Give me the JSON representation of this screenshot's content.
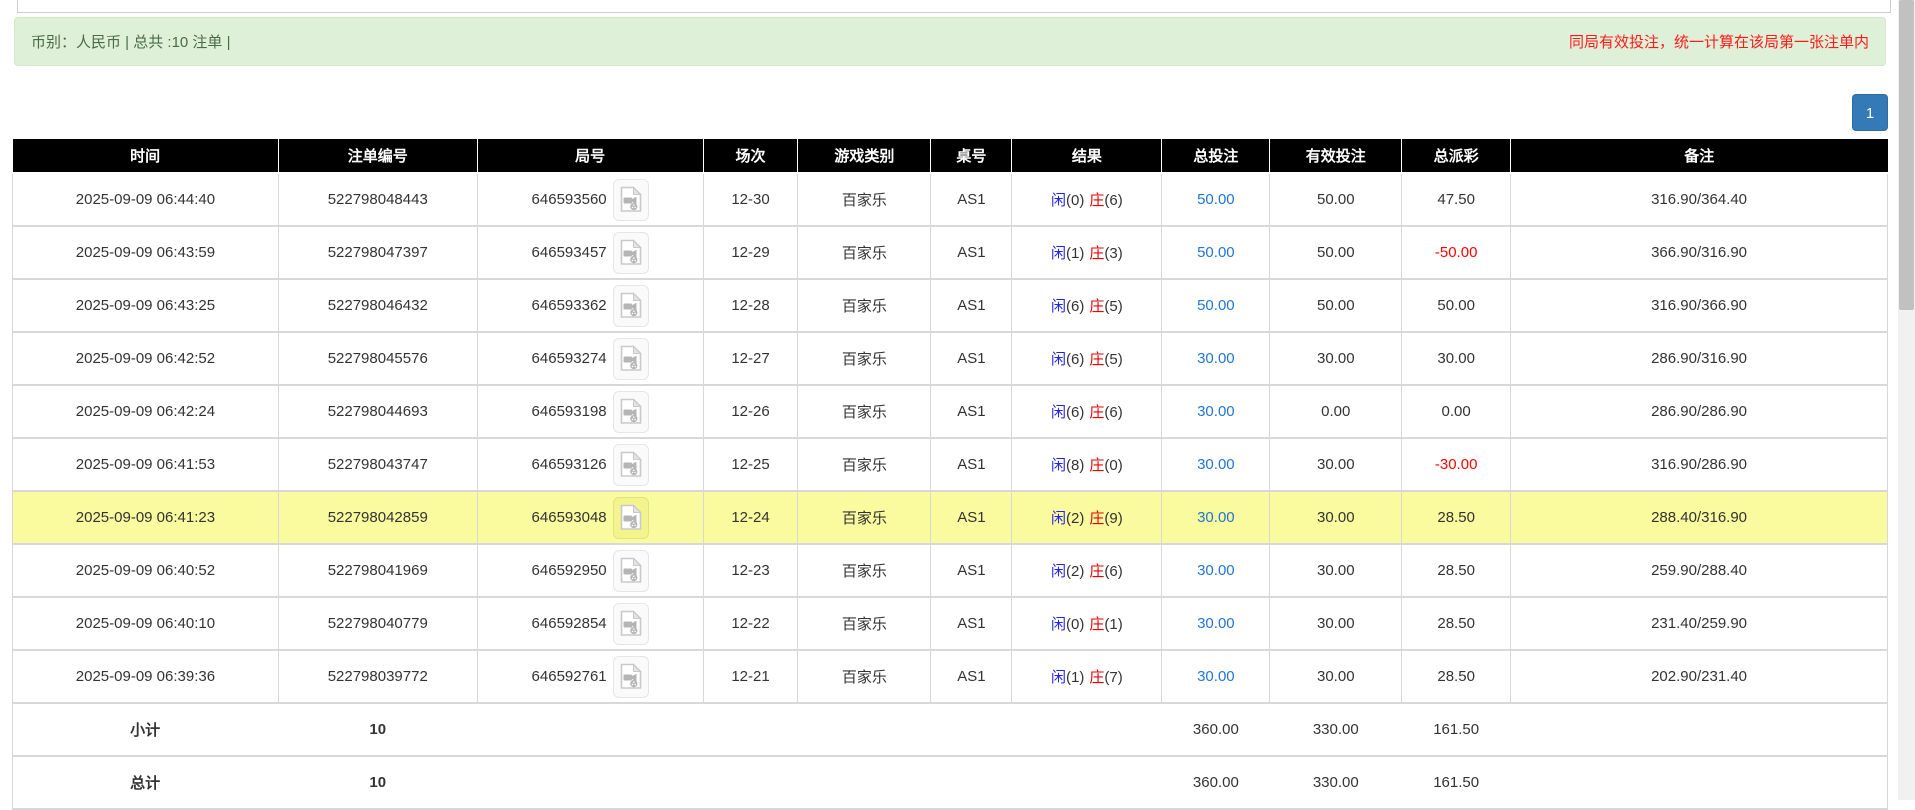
{
  "banner": {
    "left": "币别：人民币 | 总共 :10 注单 |",
    "right": "同局有效投注，统一计算在该局第一张注单内"
  },
  "pagination": {
    "page": "1"
  },
  "table": {
    "headers": [
      "时间",
      "注单编号",
      "局号",
      "场次",
      "游戏类别",
      "桌号",
      "结果",
      "总投注",
      "有效投注",
      "总派彩",
      "备注"
    ],
    "rows": [
      {
        "time": "2025-09-09 06:44:40",
        "bet_id": "522798048443",
        "round_id": "646593560",
        "session": "12-30",
        "game_type": "百家乐",
        "table_no": "AS1",
        "result_player": "闲",
        "result_player_num": "(0)",
        "result_banker": "庄",
        "result_banker_num": "(6)",
        "total_bet": "50.00",
        "valid_bet": "50.00",
        "payout": "47.50",
        "payout_negative": false,
        "remark": "316.90/364.40",
        "highlighted": false
      },
      {
        "time": "2025-09-09 06:43:59",
        "bet_id": "522798047397",
        "round_id": "646593457",
        "session": "12-29",
        "game_type": "百家乐",
        "table_no": "AS1",
        "result_player": "闲",
        "result_player_num": "(1)",
        "result_banker": "庄",
        "result_banker_num": "(3)",
        "total_bet": "50.00",
        "valid_bet": "50.00",
        "payout": "-50.00",
        "payout_negative": true,
        "remark": "366.90/316.90",
        "highlighted": false
      },
      {
        "time": "2025-09-09 06:43:25",
        "bet_id": "522798046432",
        "round_id": "646593362",
        "session": "12-28",
        "game_type": "百家乐",
        "table_no": "AS1",
        "result_player": "闲",
        "result_player_num": "(6)",
        "result_banker": "庄",
        "result_banker_num": "(5)",
        "total_bet": "50.00",
        "valid_bet": "50.00",
        "payout": "50.00",
        "payout_negative": false,
        "remark": "316.90/366.90",
        "highlighted": false
      },
      {
        "time": "2025-09-09 06:42:52",
        "bet_id": "522798045576",
        "round_id": "646593274",
        "session": "12-27",
        "game_type": "百家乐",
        "table_no": "AS1",
        "result_player": "闲",
        "result_player_num": "(6)",
        "result_banker": "庄",
        "result_banker_num": "(5)",
        "total_bet": "30.00",
        "valid_bet": "30.00",
        "payout": "30.00",
        "payout_negative": false,
        "remark": "286.90/316.90",
        "highlighted": false
      },
      {
        "time": "2025-09-09 06:42:24",
        "bet_id": "522798044693",
        "round_id": "646593198",
        "session": "12-26",
        "game_type": "百家乐",
        "table_no": "AS1",
        "result_player": "闲",
        "result_player_num": "(6)",
        "result_banker": "庄",
        "result_banker_num": "(6)",
        "total_bet": "30.00",
        "valid_bet": "0.00",
        "payout": "0.00",
        "payout_negative": false,
        "remark": "286.90/286.90",
        "highlighted": false
      },
      {
        "time": "2025-09-09 06:41:53",
        "bet_id": "522798043747",
        "round_id": "646593126",
        "session": "12-25",
        "game_type": "百家乐",
        "table_no": "AS1",
        "result_player": "闲",
        "result_player_num": "(8)",
        "result_banker": "庄",
        "result_banker_num": "(0)",
        "total_bet": "30.00",
        "valid_bet": "30.00",
        "payout": "-30.00",
        "payout_negative": true,
        "remark": "316.90/286.90",
        "highlighted": false
      },
      {
        "time": "2025-09-09 06:41:23",
        "bet_id": "522798042859",
        "round_id": "646593048",
        "session": "12-24",
        "game_type": "百家乐",
        "table_no": "AS1",
        "result_player": "闲",
        "result_player_num": "(2)",
        "result_banker": "庄",
        "result_banker_num": "(9)",
        "total_bet": "30.00",
        "valid_bet": "30.00",
        "payout": "28.50",
        "payout_negative": false,
        "remark": "288.40/316.90",
        "highlighted": true
      },
      {
        "time": "2025-09-09 06:40:52",
        "bet_id": "522798041969",
        "round_id": "646592950",
        "session": "12-23",
        "game_type": "百家乐",
        "table_no": "AS1",
        "result_player": "闲",
        "result_player_num": "(2)",
        "result_banker": "庄",
        "result_banker_num": "(6)",
        "total_bet": "30.00",
        "valid_bet": "30.00",
        "payout": "28.50",
        "payout_negative": false,
        "remark": "259.90/288.40",
        "highlighted": false
      },
      {
        "time": "2025-09-09 06:40:10",
        "bet_id": "522798040779",
        "round_id": "646592854",
        "session": "12-22",
        "game_type": "百家乐",
        "table_no": "AS1",
        "result_player": "闲",
        "result_player_num": "(0)",
        "result_banker": "庄",
        "result_banker_num": "(1)",
        "total_bet": "30.00",
        "valid_bet": "30.00",
        "payout": "28.50",
        "payout_negative": false,
        "remark": "231.40/259.90",
        "highlighted": false
      },
      {
        "time": "2025-09-09 06:39:36",
        "bet_id": "522798039772",
        "round_id": "646592761",
        "session": "12-21",
        "game_type": "百家乐",
        "table_no": "AS1",
        "result_player": "闲",
        "result_player_num": "(1)",
        "result_banker": "庄",
        "result_banker_num": "(7)",
        "total_bet": "30.00",
        "valid_bet": "30.00",
        "payout": "28.50",
        "payout_negative": false,
        "remark": "202.90/231.40",
        "highlighted": false
      }
    ],
    "subtotal": {
      "label": "小计",
      "count": "10",
      "total_bet": "360.00",
      "valid_bet": "330.00",
      "payout": "161.50"
    },
    "total": {
      "label": "总计",
      "count": "10",
      "total_bet": "360.00",
      "valid_bet": "330.00",
      "payout": "161.50"
    }
  },
  "icons": {
    "video_icon": "video-file-icon"
  },
  "colors": {
    "header_bg": "#000000",
    "banner_bg": "#dff0d8",
    "banner_border": "#d6e9c6",
    "banner_text": "#4a6b4a",
    "notice_red": "#ff1a1a",
    "link_blue": "#2276d2",
    "player_blue": "#2222ee",
    "banker_red": "#e60000",
    "negative_red": "#ff0000",
    "highlight_yellow": "#fafa9e",
    "footer_bg": "#9b9b9b",
    "pagination_blue": "#337ab7"
  }
}
